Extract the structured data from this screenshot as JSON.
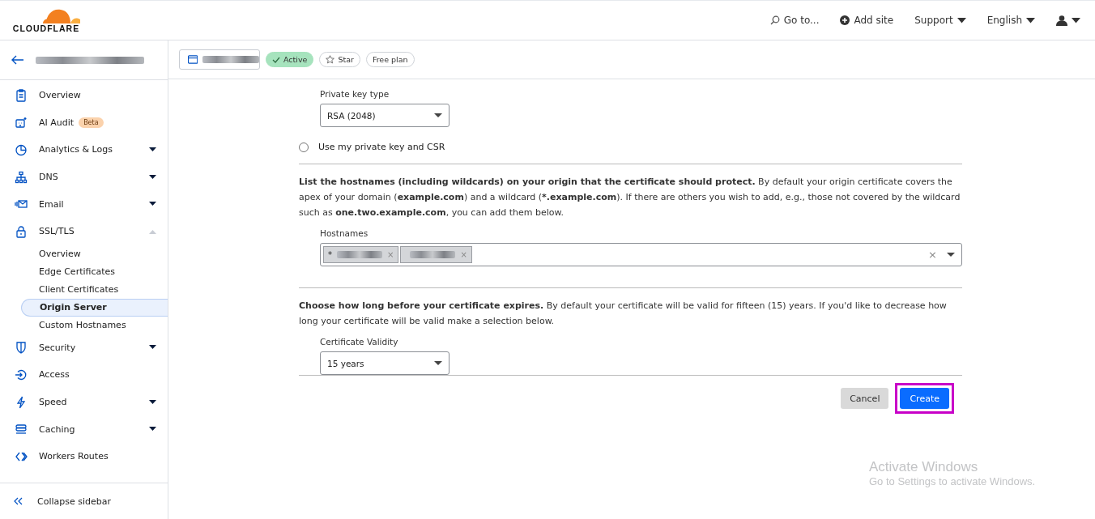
{
  "header": {
    "logo": "CLOUDFLARE",
    "actions": [
      {
        "kind": "search",
        "label": "Go to..."
      },
      {
        "kind": "add",
        "label": "Add site"
      },
      {
        "kind": "menu",
        "label": "Support"
      },
      {
        "kind": "menu",
        "label": "English"
      },
      {
        "kind": "user"
      }
    ]
  },
  "zone_bar": {
    "status": "Active",
    "star": "Star",
    "plan": "Free plan"
  },
  "sidebar": {
    "items": [
      {
        "label": "Overview"
      },
      {
        "label": "AI Audit",
        "badge": "Beta"
      },
      {
        "label": "Analytics & Logs",
        "expanded": false
      },
      {
        "label": "DNS",
        "expanded": false
      },
      {
        "label": "Email",
        "expanded": false
      },
      {
        "label": "SSL/TLS",
        "expanded": true,
        "children": [
          {
            "label": "Overview",
            "selected": false
          },
          {
            "label": "Edge Certificates",
            "selected": false
          },
          {
            "label": "Client Certificates",
            "selected": false
          },
          {
            "label": "Origin Server",
            "selected": true
          },
          {
            "label": "Custom Hostnames",
            "selected": false
          }
        ]
      },
      {
        "label": "Security",
        "expanded": false
      },
      {
        "label": "Access"
      },
      {
        "label": "Speed",
        "expanded": false
      },
      {
        "label": "Caching",
        "expanded": false
      },
      {
        "label": "Workers Routes"
      }
    ],
    "collapse": "Collapse sidebar"
  },
  "form": {
    "key_type": {
      "label": "Private key type",
      "value": "RSA (2048)"
    },
    "radio": {
      "label": "Use my private key and CSR",
      "selected": false
    },
    "hostnames_text": "**List the hostnames (including wildcards) on your origin that the certificate should protect.** By default your origin certificate covers the apex of your domain (**example.com**) and a wildcard (***.example.com**). If there are others you wish to add, e.g., those not covered by the wildcard such as **one.two.example.com**, you can add them below.",
    "hostnames": {
      "label": "Hostnames",
      "tags": [
        {
          "prefix": "*",
          "remove": "×"
        },
        {
          "remove": "×"
        }
      ],
      "clear": "×"
    },
    "validity_text": "**Choose how long before your certificate expires.** By default your certificate will be valid for fifteen (15) years. If you'd like to decrease how long your certificate will be valid make a selection below.",
    "validity": {
      "label": "Certificate Validity",
      "value": "15 years"
    },
    "buttons": [
      {
        "kind": "secondary",
        "label": "Cancel"
      },
      {
        "kind": "primary",
        "label": "Create",
        "highlighted": true
      }
    ]
  },
  "watermark": {
    "title": "Activate Windows",
    "subtitle": "Go to Settings to activate Windows."
  }
}
